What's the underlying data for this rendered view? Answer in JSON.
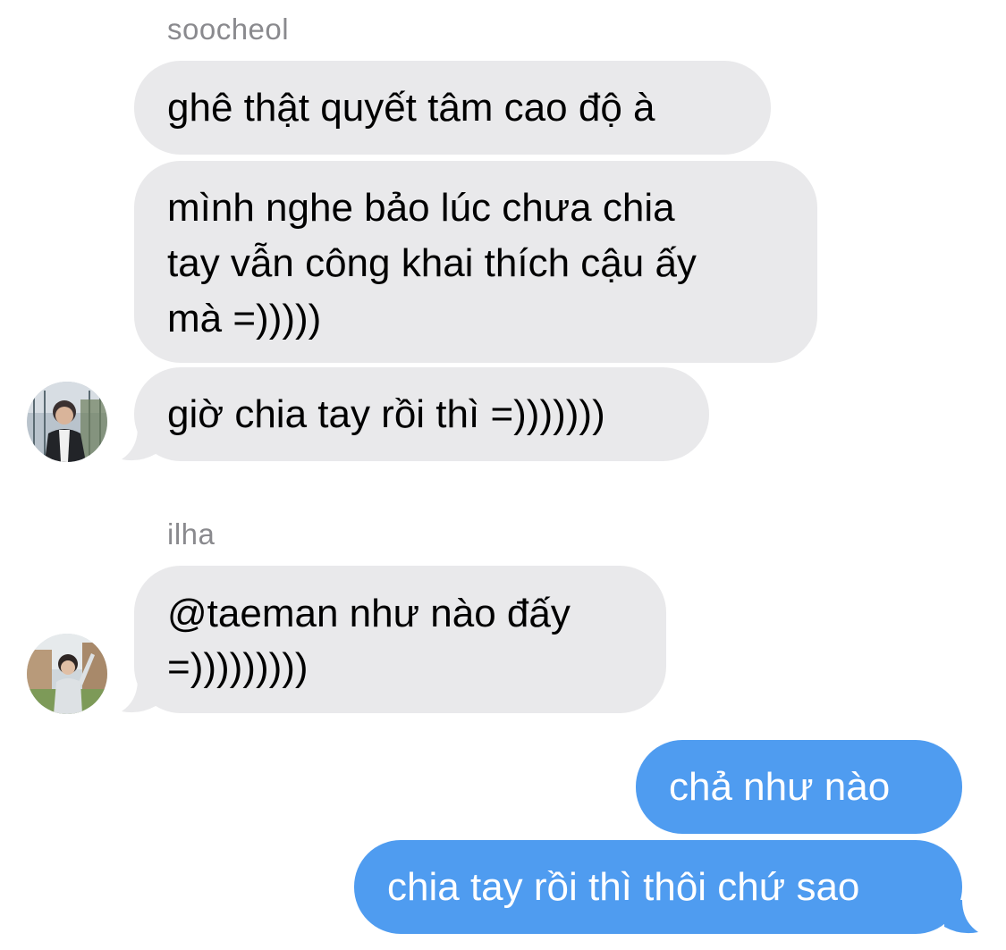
{
  "messages": {
    "group1": {
      "sender": "soocheol",
      "bubbles": [
        "ghê thật quyết tâm cao độ à",
        "mình nghe bảo lúc chưa chia",
        "tay vẫn công khai thích cậu ấy",
        "mà =)))))",
        "giờ chia tay rồi thì =)))))))"
      ]
    },
    "group2": {
      "sender": "ilha",
      "line1": "@taeman như nào đấy",
      "line2": "=)))))))))"
    },
    "outgoing": [
      "chả như nào",
      "chia tay rồi thì thôi chứ sao"
    ]
  },
  "colors": {
    "incoming_bubble": "#e9e9eb",
    "outgoing_bubble": "#4f9cf0",
    "sender_label": "#8a8a8e"
  },
  "icons": {
    "avatar1": "avatar-photo-man-jacket",
    "avatar2": "avatar-photo-man-outdoors"
  }
}
